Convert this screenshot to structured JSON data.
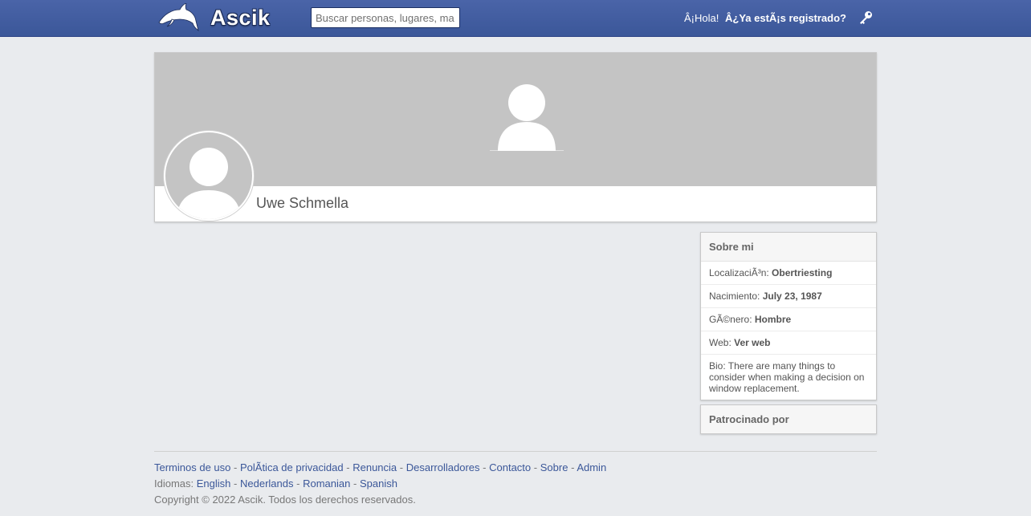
{
  "header": {
    "logo_text": "Ascik",
    "search_placeholder": "Buscar personas, lugares, ma",
    "greeting": "Â¡Hola!",
    "register_prompt": "Â¿Ya estÃ¡s registrado?"
  },
  "profile": {
    "name": "Uwe Schmella"
  },
  "about": {
    "title": "Sobre mi",
    "rows": [
      {
        "label": "LocalizaciÃ³n:",
        "value": "Obertriesting"
      },
      {
        "label": "Nacimiento:",
        "value": "July 23, 1987"
      },
      {
        "label": "GÃ©nero:",
        "value": "Hombre"
      },
      {
        "label": "Web:",
        "value": "Ver web"
      }
    ],
    "bio": "Bio: There are many things to consider when making a decision on window replacement."
  },
  "sponsor": {
    "title": "Patrocinado por"
  },
  "footer": {
    "links": [
      "Terminos de uso",
      "PolÃtica de privacidad",
      "Renuncia",
      "Desarrolladores",
      "Contacto",
      "Sobre",
      "Admin"
    ],
    "languages_label": "Idiomas:",
    "languages": [
      "English",
      "Nederlands",
      "Romanian",
      "Spanish"
    ],
    "copyright": "Copyright © 2022 Ascik. Todos los derechos reservados."
  },
  "colors": {
    "header_blue": "#3b5799",
    "page_bg": "#e9ebee",
    "link": "#3b5799"
  }
}
